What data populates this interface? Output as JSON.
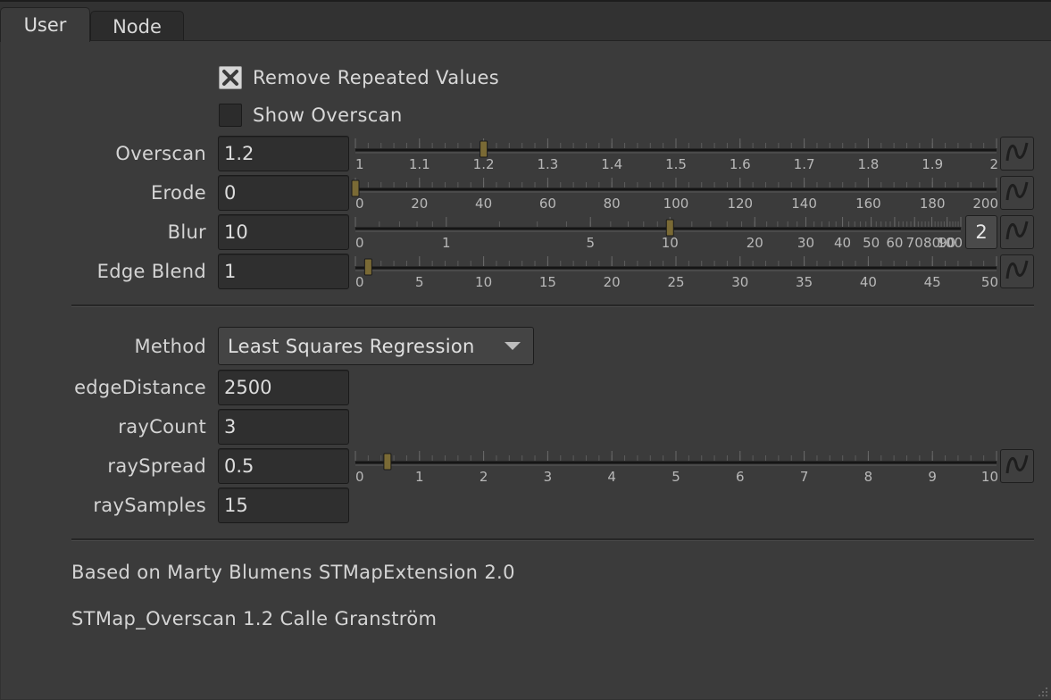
{
  "tabs": [
    {
      "label": "User",
      "active": true
    },
    {
      "label": "Node",
      "active": false
    }
  ],
  "checkboxes": [
    {
      "label": "Remove Repeated Values",
      "checked": true
    },
    {
      "label": "Show Overscan",
      "checked": false
    }
  ],
  "params": {
    "overscan": {
      "label": "Overscan",
      "value": "1.2"
    },
    "erode": {
      "label": "Erode",
      "value": "0"
    },
    "blur": {
      "label": "Blur",
      "value": "10"
    },
    "edge_blend": {
      "label": "Edge Blend",
      "value": "1"
    },
    "method": {
      "label": "Method",
      "value": "Least Squares Regression"
    },
    "edge_distance": {
      "label": "edgeDistance",
      "value": "2500"
    },
    "ray_count": {
      "label": "rayCount",
      "value": "3"
    },
    "ray_spread": {
      "label": "raySpread",
      "value": "0.5"
    },
    "ray_samples": {
      "label": "raySamples",
      "value": "15"
    }
  },
  "blur_multi_button": "2",
  "sliders": {
    "overscan": {
      "min": 1,
      "max": 2,
      "value": 1.2,
      "scale": "linear",
      "ticks": [
        "1",
        "1.1",
        "1.2",
        "1.3",
        "1.4",
        "1.5",
        "1.6",
        "1.7",
        "1.8",
        "1.9",
        "2"
      ]
    },
    "erode": {
      "min": 0,
      "max": 200,
      "value": 0,
      "scale": "linear",
      "ticks": [
        "0",
        "20",
        "40",
        "60",
        "80",
        "100",
        "120",
        "140",
        "160",
        "180",
        "200"
      ]
    },
    "blur": {
      "min": 0,
      "max": 100,
      "value": 10,
      "scale": "log",
      "ticks": [
        "0",
        "1",
        "5",
        "10",
        "20",
        "30",
        "40",
        "50",
        "60",
        "70",
        "80",
        "90",
        "100"
      ]
    },
    "edge_blend": {
      "min": 0,
      "max": 50,
      "value": 1,
      "scale": "linear",
      "ticks": [
        "0",
        "5",
        "10",
        "15",
        "20",
        "25",
        "30",
        "35",
        "40",
        "45",
        "50"
      ]
    },
    "ray_spread": {
      "min": 0,
      "max": 10,
      "value": 0.5,
      "scale": "linear",
      "ticks": [
        "0",
        "1",
        "2",
        "3",
        "4",
        "5",
        "6",
        "7",
        "8",
        "9",
        "10"
      ]
    }
  },
  "notes": {
    "line1": "Based on Marty Blumens STMapExtension 2.0",
    "line2": "STMap_Overscan 1.2 Calle Granström"
  },
  "colors": {
    "panel": "#3b3b3b",
    "field": "#2f2f2f",
    "slider_handle": "#7a6a35"
  },
  "icons": [
    "checkmark-x-icon",
    "animation-curve-icon",
    "dropdown-arrow-icon"
  ]
}
